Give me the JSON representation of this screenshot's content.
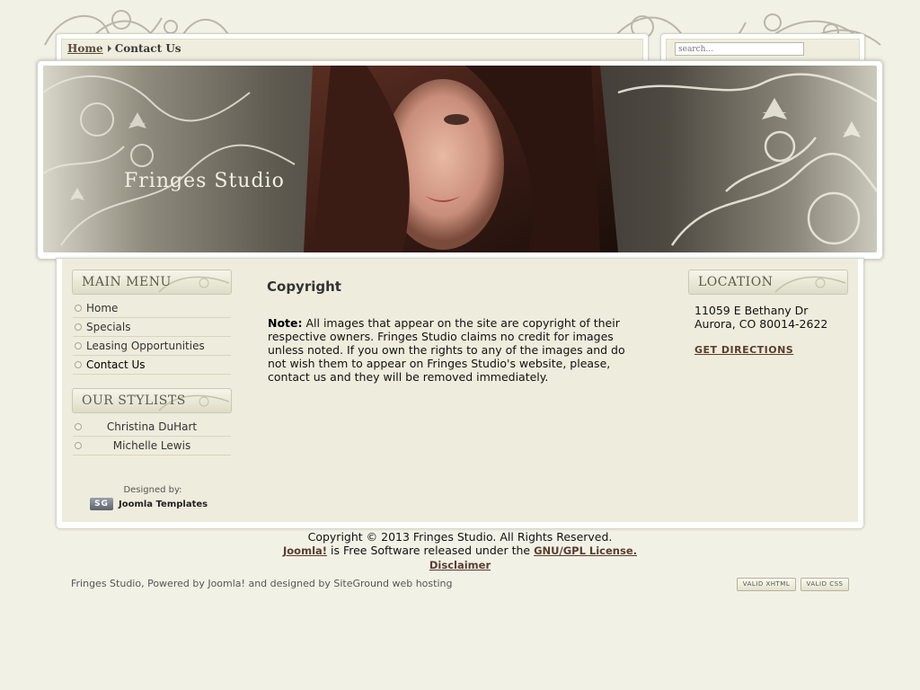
{
  "breadcrumb": {
    "home": "Home",
    "current": "Contact Us"
  },
  "search": {
    "placeholder": "search..."
  },
  "header": {
    "site_title": "Fringes Studio"
  },
  "main_menu": {
    "title": "MAIN MENU",
    "items": [
      "Home",
      "Specials",
      "Leasing Opportunities",
      "Contact Us"
    ]
  },
  "stylists": {
    "title": "OUR STYLISTS",
    "items": [
      "Christina DuHart",
      "Michelle Lewis"
    ]
  },
  "designed_by": {
    "label": "Designed by:",
    "logo_text": "SG",
    "link": "Joomla Templates"
  },
  "content": {
    "title": "Copyright",
    "note_label": "Note:",
    "note_text": " All images that appear on the site are copyright of their respective owners. Fringes Studio claims no credit for images unless noted. If you own the rights to any of the images and do not wish them to appear on Fringes Studio's website, please, contact us and they will be removed immediately."
  },
  "location": {
    "title": "LOCATION",
    "line1": "11059 E Bethany Dr",
    "line2": "Aurora, CO 80014-2622",
    "directions": "GET DIRECTIONS"
  },
  "footer": {
    "copyright": "Copyright © 2013 Fringes Studio. All Rights Reserved.",
    "joomla": "Joomla!",
    "joomla_rest": " is Free Software released under the ",
    "license": "GNU/GPL License.",
    "disclaimer": "Disclaimer",
    "powered": "Fringes Studio, Powered by Joomla! and designed by SiteGround web hosting",
    "badge_xhtml": "VALID XHTML",
    "badge_css": "VALID CSS"
  },
  "colors": {
    "background": "#f2f1e6",
    "panel": "#eeecdc",
    "link": "#5a3d30"
  }
}
